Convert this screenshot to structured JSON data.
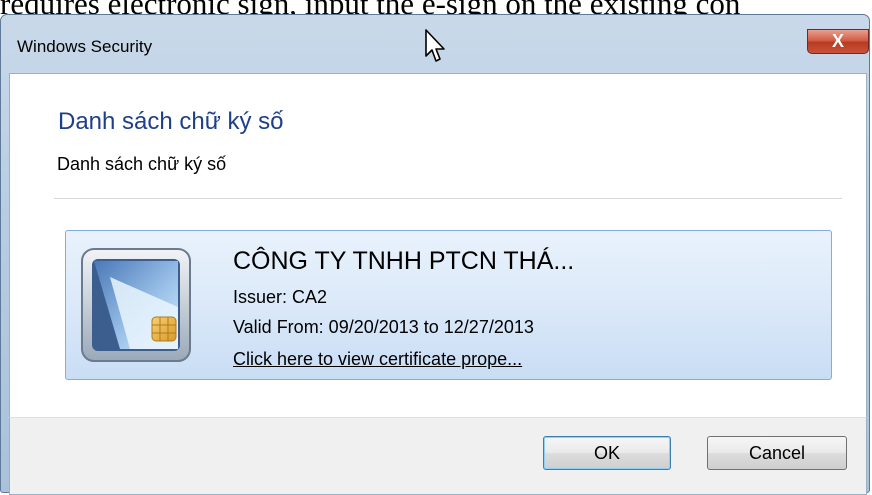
{
  "background_text": "requires electronic sign, input the e-sign on the existing con",
  "window": {
    "title": "Windows Security",
    "close_label": "X"
  },
  "dialog": {
    "heading": "Danh sách chữ ký số",
    "subheading": "Danh sách chữ ký số"
  },
  "certificate": {
    "name": "CÔNG TY TNHH PTCN THÁ...",
    "issuer": "Issuer: CA2",
    "valid": "Valid From: 09/20/2013 to 12/27/2013",
    "link": "Click here to view certificate prope..."
  },
  "buttons": {
    "ok": "OK",
    "cancel": "Cancel"
  },
  "icons": {
    "card": "smart-card-icon",
    "close": "close-icon",
    "cursor": "mouse-cursor-icon"
  },
  "colors": {
    "heading": "#1e3f8a",
    "card_bg": "#dbe9f9",
    "close_button": "#c9523a"
  }
}
